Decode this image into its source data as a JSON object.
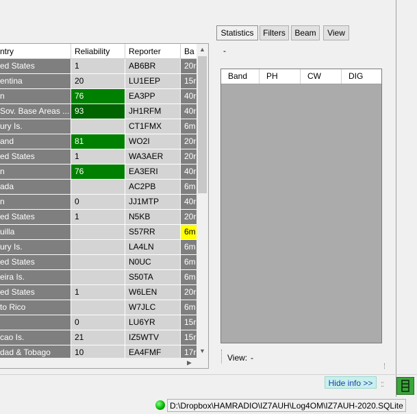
{
  "grid": {
    "columns": [
      "ntry",
      "Reliability",
      "Reporter",
      "Ba"
    ],
    "rows": [
      {
        "country": "ed States",
        "reliability": "1",
        "reporter": "AB6BR",
        "band": "20r",
        "rel_color": "",
        "band_color": ""
      },
      {
        "country": "entina",
        "reliability": "20",
        "reporter": "LU1EEP",
        "band": "15r",
        "rel_color": "",
        "band_color": ""
      },
      {
        "country": "n",
        "reliability": "76",
        "reporter": "EA3PP",
        "band": "40r",
        "rel_color": "#008000",
        "band_color": ""
      },
      {
        "country": "Sov. Base Areas ...",
        "reliability": "93",
        "reporter": "JH1RFM",
        "band": "40r",
        "rel_color": "#006400",
        "band_color": ""
      },
      {
        "country": "ury Is.",
        "reliability": "",
        "reporter": "CT1FMX",
        "band": "6m",
        "rel_color": "",
        "band_color": ""
      },
      {
        "country": "and",
        "reliability": "81",
        "reporter": "WO2I",
        "band": "20r",
        "rel_color": "#008000",
        "band_color": ""
      },
      {
        "country": "ed States",
        "reliability": "1",
        "reporter": "WA3AER",
        "band": "20r",
        "rel_color": "",
        "band_color": ""
      },
      {
        "country": "n",
        "reliability": "76",
        "reporter": "EA3ERI",
        "band": "40r",
        "rel_color": "#008000",
        "band_color": ""
      },
      {
        "country": "ada",
        "reliability": "",
        "reporter": "AC2PB",
        "band": "6m",
        "rel_color": "",
        "band_color": ""
      },
      {
        "country": "n",
        "reliability": "0",
        "reporter": "JJ1MTP",
        "band": "40r",
        "rel_color": "",
        "band_color": ""
      },
      {
        "country": "ed States",
        "reliability": "1",
        "reporter": "N5KB",
        "band": "20r",
        "rel_color": "",
        "band_color": ""
      },
      {
        "country": "uilla",
        "reliability": "",
        "reporter": "S57RR",
        "band": "6m",
        "rel_color": "",
        "band_color": "#ffff00"
      },
      {
        "country": "ury Is.",
        "reliability": "",
        "reporter": "LA4LN",
        "band": "6m",
        "rel_color": "",
        "band_color": ""
      },
      {
        "country": "ed States",
        "reliability": "",
        "reporter": "N0UC",
        "band": "6m",
        "rel_color": "",
        "band_color": ""
      },
      {
        "country": "eira Is.",
        "reliability": "",
        "reporter": "S50TA",
        "band": "6m",
        "rel_color": "",
        "band_color": ""
      },
      {
        "country": "ed States",
        "reliability": "1",
        "reporter": "W6LEN",
        "band": "20r",
        "rel_color": "",
        "band_color": ""
      },
      {
        "country": "to Rico",
        "reliability": "",
        "reporter": "W7JLC",
        "band": "6m",
        "rel_color": "",
        "band_color": ""
      },
      {
        "country": "",
        "reliability": "0",
        "reporter": "LU6YR",
        "band": "15r",
        "rel_color": "",
        "band_color": ""
      },
      {
        "country": "cao Is.",
        "reliability": "21",
        "reporter": "IZ5WTV",
        "band": "15r",
        "rel_color": "",
        "band_color": ""
      },
      {
        "country": "dad & Tobago",
        "reliability": "10",
        "reporter": "EA4FMF",
        "band": "17r",
        "rel_color": "",
        "band_color": ""
      }
    ]
  },
  "tabs": [
    {
      "label": "Statistics",
      "active": true
    },
    {
      "label": "Filters",
      "active": false
    },
    {
      "label": "Beam",
      "active": false
    },
    {
      "label": "View",
      "active": false
    }
  ],
  "stats": {
    "dash": "-",
    "columns": [
      "Band",
      "PH",
      "CW",
      "DIG"
    ],
    "view_label": "View:",
    "view_value": "-"
  },
  "hide_info_label": "Hide info >>",
  "status": {
    "path": "D:\\Dropbox\\HAMRADIO\\IZ7AUH\\Log4OM\\IZ7AUH-2020.SQLite",
    "indicator_color": "#00b000"
  },
  "colors": {
    "header_bg": "#ffffff",
    "country_bg": "#7f7f7f",
    "cell_bg": "#d4d4d4",
    "panel_gray": "#ababab",
    "hide_info_bg": "#c8f0ec"
  }
}
